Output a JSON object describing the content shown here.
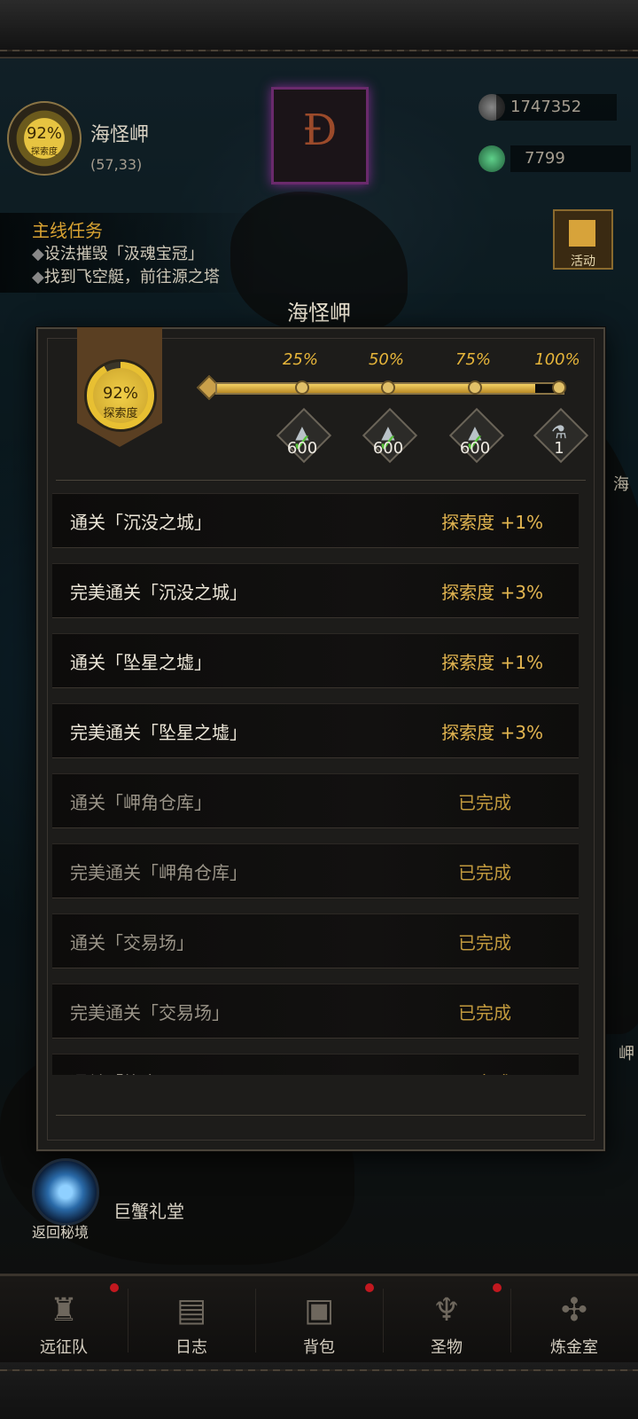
{
  "hud": {
    "exploration_badge": {
      "percent": "92%",
      "label": "探索度"
    },
    "location": {
      "name": "海怪岬",
      "coords": "(57,33)"
    },
    "resources": [
      {
        "icon": "stone-ore-icon",
        "value": "1747352"
      },
      {
        "icon": "green-gem-icon",
        "value": "7799"
      }
    ],
    "quest": {
      "title": "主线任务",
      "lines": [
        "设法摧毁「汲魂宝冠」",
        "找到飞空艇，前往源之塔"
      ]
    },
    "activity": {
      "label": "活动",
      "icon": "gift-box-icon"
    },
    "edge_labels": [
      "海",
      "岬"
    ],
    "portal": {
      "label": "返回秘境",
      "icon": "portal-vortex-icon"
    },
    "area_label": "巨蟹礼堂"
  },
  "modal": {
    "title": "海怪岬",
    "badge": {
      "percent": "92%",
      "label": "探索度",
      "progress": 0.92
    },
    "milestones": [
      {
        "pct": "25%",
        "amount": "600",
        "icon": "ore-chunk-icon",
        "claimed": true
      },
      {
        "pct": "50%",
        "amount": "600",
        "icon": "ore-chunk-icon",
        "claimed": true
      },
      {
        "pct": "75%",
        "amount": "600",
        "icon": "ore-chunk-icon",
        "claimed": true
      },
      {
        "pct": "100%",
        "amount": "1",
        "icon": "potion-bottle-icon",
        "claimed": false
      }
    ],
    "tasks": [
      {
        "task": "通关「沉没之城」",
        "reward": "探索度 +1%",
        "done": false
      },
      {
        "task": "完美通关「沉没之城」",
        "reward": "探索度 +3%",
        "done": false
      },
      {
        "task": "通关「坠星之墟」",
        "reward": "探索度 +1%",
        "done": false
      },
      {
        "task": "完美通关「坠星之墟」",
        "reward": "探索度 +3%",
        "done": false
      },
      {
        "task": "通关「岬角仓库」",
        "reward": "已完成",
        "done": true
      },
      {
        "task": "完美通关「岬角仓库」",
        "reward": "已完成",
        "done": true
      },
      {
        "task": "通关「交易场」",
        "reward": "已完成",
        "done": true
      },
      {
        "task": "完美通关「交易场」",
        "reward": "已完成",
        "done": true
      },
      {
        "task": "通关「旅舍」",
        "reward": "已完成",
        "done": true
      }
    ]
  },
  "nav": [
    {
      "label": "远征队",
      "icon": "horned-helmet-icon",
      "badge": true
    },
    {
      "label": "日志",
      "icon": "scroll-map-icon",
      "badge": false
    },
    {
      "label": "背包",
      "icon": "backpack-icon",
      "badge": true
    },
    {
      "label": "圣物",
      "icon": "chalice-icon",
      "badge": true
    },
    {
      "label": "炼金室",
      "icon": "alchemy-icon",
      "badge": false
    }
  ],
  "colors": {
    "accent_gold": "#e6b53a",
    "done_text": "#9a9488",
    "badge_red": "#c2181f",
    "check_green": "#57c23a"
  }
}
